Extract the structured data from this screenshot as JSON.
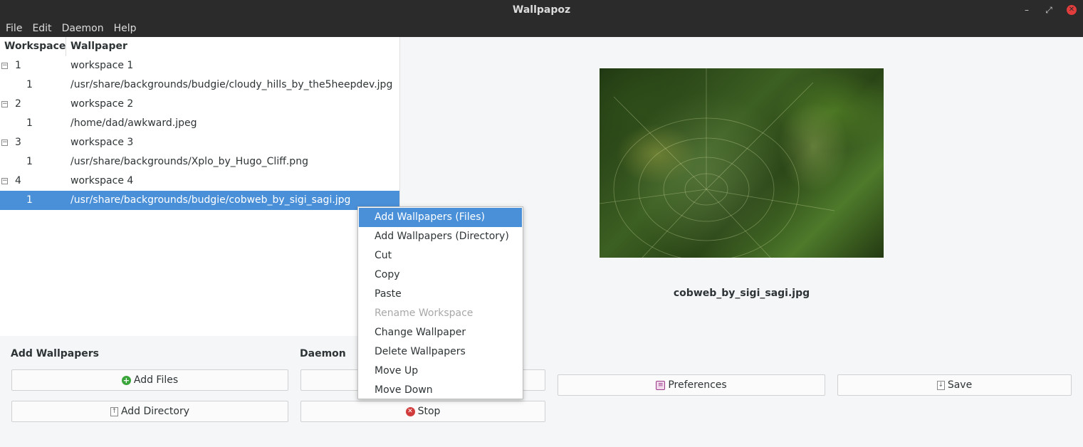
{
  "window": {
    "title": "Wallpapoz",
    "controls": {
      "minimize": "–",
      "maximize": "⤢",
      "close": "✕"
    }
  },
  "menubar": [
    "File",
    "Edit",
    "Daemon",
    "Help"
  ],
  "tree": {
    "columns": [
      "Workspace",
      "Wallpaper"
    ],
    "rows": [
      {
        "col1": "1",
        "col2": "workspace 1",
        "is_parent": true,
        "selected": false
      },
      {
        "col1": "1",
        "col2": "/usr/share/backgrounds/budgie/cloudy_hills_by_the5heepdev.jpg",
        "is_parent": false,
        "selected": false
      },
      {
        "col1": "2",
        "col2": "workspace 2",
        "is_parent": true,
        "selected": false
      },
      {
        "col1": "1",
        "col2": "/home/dad/awkward.jpeg",
        "is_parent": false,
        "selected": false
      },
      {
        "col1": "3",
        "col2": "workspace 3",
        "is_parent": true,
        "selected": false
      },
      {
        "col1": "1",
        "col2": "/usr/share/backgrounds/Xplo_by_Hugo_Cliff.png",
        "is_parent": false,
        "selected": false
      },
      {
        "col1": "4",
        "col2": "workspace 4",
        "is_parent": true,
        "selected": false
      },
      {
        "col1": "1",
        "col2": "/usr/share/backgrounds/budgie/cobweb_by_sigi_sagi.jpg",
        "is_parent": false,
        "selected": true
      }
    ],
    "expander_glyph": "−"
  },
  "preview": {
    "caption": "cobweb_by_sigi_sagi.jpg"
  },
  "add_wallpapers": {
    "label": "Add Wallpapers",
    "add_files": "Add Files",
    "add_directory": "Add Directory"
  },
  "daemon": {
    "label": "Daemon",
    "stop": "Stop"
  },
  "toolbar": {
    "preferences": "Preferences",
    "save": "Save"
  },
  "icons": {
    "add": "+",
    "stop": "✕",
    "doc": "↑",
    "pref": "≡"
  },
  "context_menu": {
    "items": [
      {
        "label": "Add Wallpapers (Files)",
        "state": "highlight"
      },
      {
        "label": "Add Wallpapers (Directory)",
        "state": "normal"
      },
      {
        "label": "Cut",
        "state": "normal"
      },
      {
        "label": "Copy",
        "state": "normal"
      },
      {
        "label": "Paste",
        "state": "normal"
      },
      {
        "label": "Rename Workspace",
        "state": "disabled"
      },
      {
        "label": "Change Wallpaper",
        "state": "normal"
      },
      {
        "label": "Delete Wallpapers",
        "state": "normal"
      },
      {
        "label": "Move Up",
        "state": "normal"
      },
      {
        "label": "Move Down",
        "state": "normal"
      }
    ]
  },
  "colors": {
    "selection": "#4a90d9",
    "titlebar": "#2b2b2b",
    "close": "#e23d3d"
  }
}
